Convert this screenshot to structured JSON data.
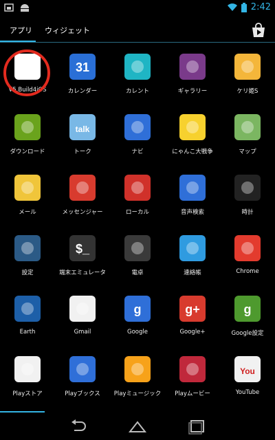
{
  "status": {
    "time": "2:42"
  },
  "tabs": {
    "apps": "アプリ",
    "widgets": "ウィジェット"
  },
  "apps": [
    {
      "label": "V5.Build4iOS",
      "icon": "miku-icon",
      "bg": "#ffffff"
    },
    {
      "label": "カレンダー",
      "icon": "calendar-icon",
      "bg": "#2a6fd6",
      "text": "31"
    },
    {
      "label": "カレント",
      "icon": "currents-icon",
      "bg": "#1fb5c4"
    },
    {
      "label": "ギャラリー",
      "icon": "gallery-icon",
      "bg": "#7a3a8a"
    },
    {
      "label": "ケリ姫S",
      "icon": "kerihime-icon",
      "bg": "#f4b63a"
    },
    {
      "label": "ダウンロード",
      "icon": "download-icon",
      "bg": "#6aa31c"
    },
    {
      "label": "トーク",
      "icon": "talk-icon",
      "bg": "#79b8e6",
      "text": "talk"
    },
    {
      "label": "ナビ",
      "icon": "navigation-icon",
      "bg": "#2f6fd8"
    },
    {
      "label": "にゃんこ大戦争",
      "icon": "nyanko-icon",
      "bg": "#f7d12e"
    },
    {
      "label": "マップ",
      "icon": "maps-icon",
      "bg": "#7bb661"
    },
    {
      "label": "メール",
      "icon": "email-icon",
      "bg": "#f0c53a"
    },
    {
      "label": "メッセンジャー",
      "icon": "messenger-icon",
      "bg": "#d83b2e"
    },
    {
      "label": "ローカル",
      "icon": "local-icon",
      "bg": "#d0312a"
    },
    {
      "label": "音声検索",
      "icon": "voice-search-icon",
      "bg": "#2f6fd8"
    },
    {
      "label": "時計",
      "icon": "clock-icon",
      "bg": "#222222"
    },
    {
      "label": "設定",
      "icon": "settings-icon",
      "bg": "#2b5a86"
    },
    {
      "label": "端末エミュレータ",
      "icon": "terminal-icon",
      "bg": "#333333",
      "text": "$_"
    },
    {
      "label": "電卓",
      "icon": "calculator-icon",
      "bg": "#3a3a3a"
    },
    {
      "label": "連絡帳",
      "icon": "contacts-icon",
      "bg": "#2f9be0"
    },
    {
      "label": "Chrome",
      "icon": "chrome-icon",
      "bg": "#e33b2e"
    },
    {
      "label": "Earth",
      "icon": "earth-icon",
      "bg": "#1d5fa8"
    },
    {
      "label": "Gmail",
      "icon": "gmail-icon",
      "bg": "#f1f1f1"
    },
    {
      "label": "Google",
      "icon": "google-icon",
      "bg": "#2f6fd8",
      "text": "g"
    },
    {
      "label": "Google+",
      "icon": "google-plus-icon",
      "bg": "#d83b2e",
      "text": "g+"
    },
    {
      "label": "Google設定",
      "icon": "google-settings-icon",
      "bg": "#4e9a2e",
      "text": "g"
    },
    {
      "label": "Playストア",
      "icon": "play-store-icon",
      "bg": "#f1f1f1"
    },
    {
      "label": "Playブックス",
      "icon": "play-books-icon",
      "bg": "#2f6fd8"
    },
    {
      "label": "Playミュージック",
      "icon": "play-music-icon",
      "bg": "#f7a21a"
    },
    {
      "label": "Playムービー",
      "icon": "play-movies-icon",
      "bg": "#c0283b"
    },
    {
      "label": "YouTube",
      "icon": "youtube-icon",
      "bg": "#f1f1f1",
      "text": "You"
    }
  ],
  "colors": {
    "accent": "#33b5e5",
    "highlight": "#e32b1f"
  }
}
